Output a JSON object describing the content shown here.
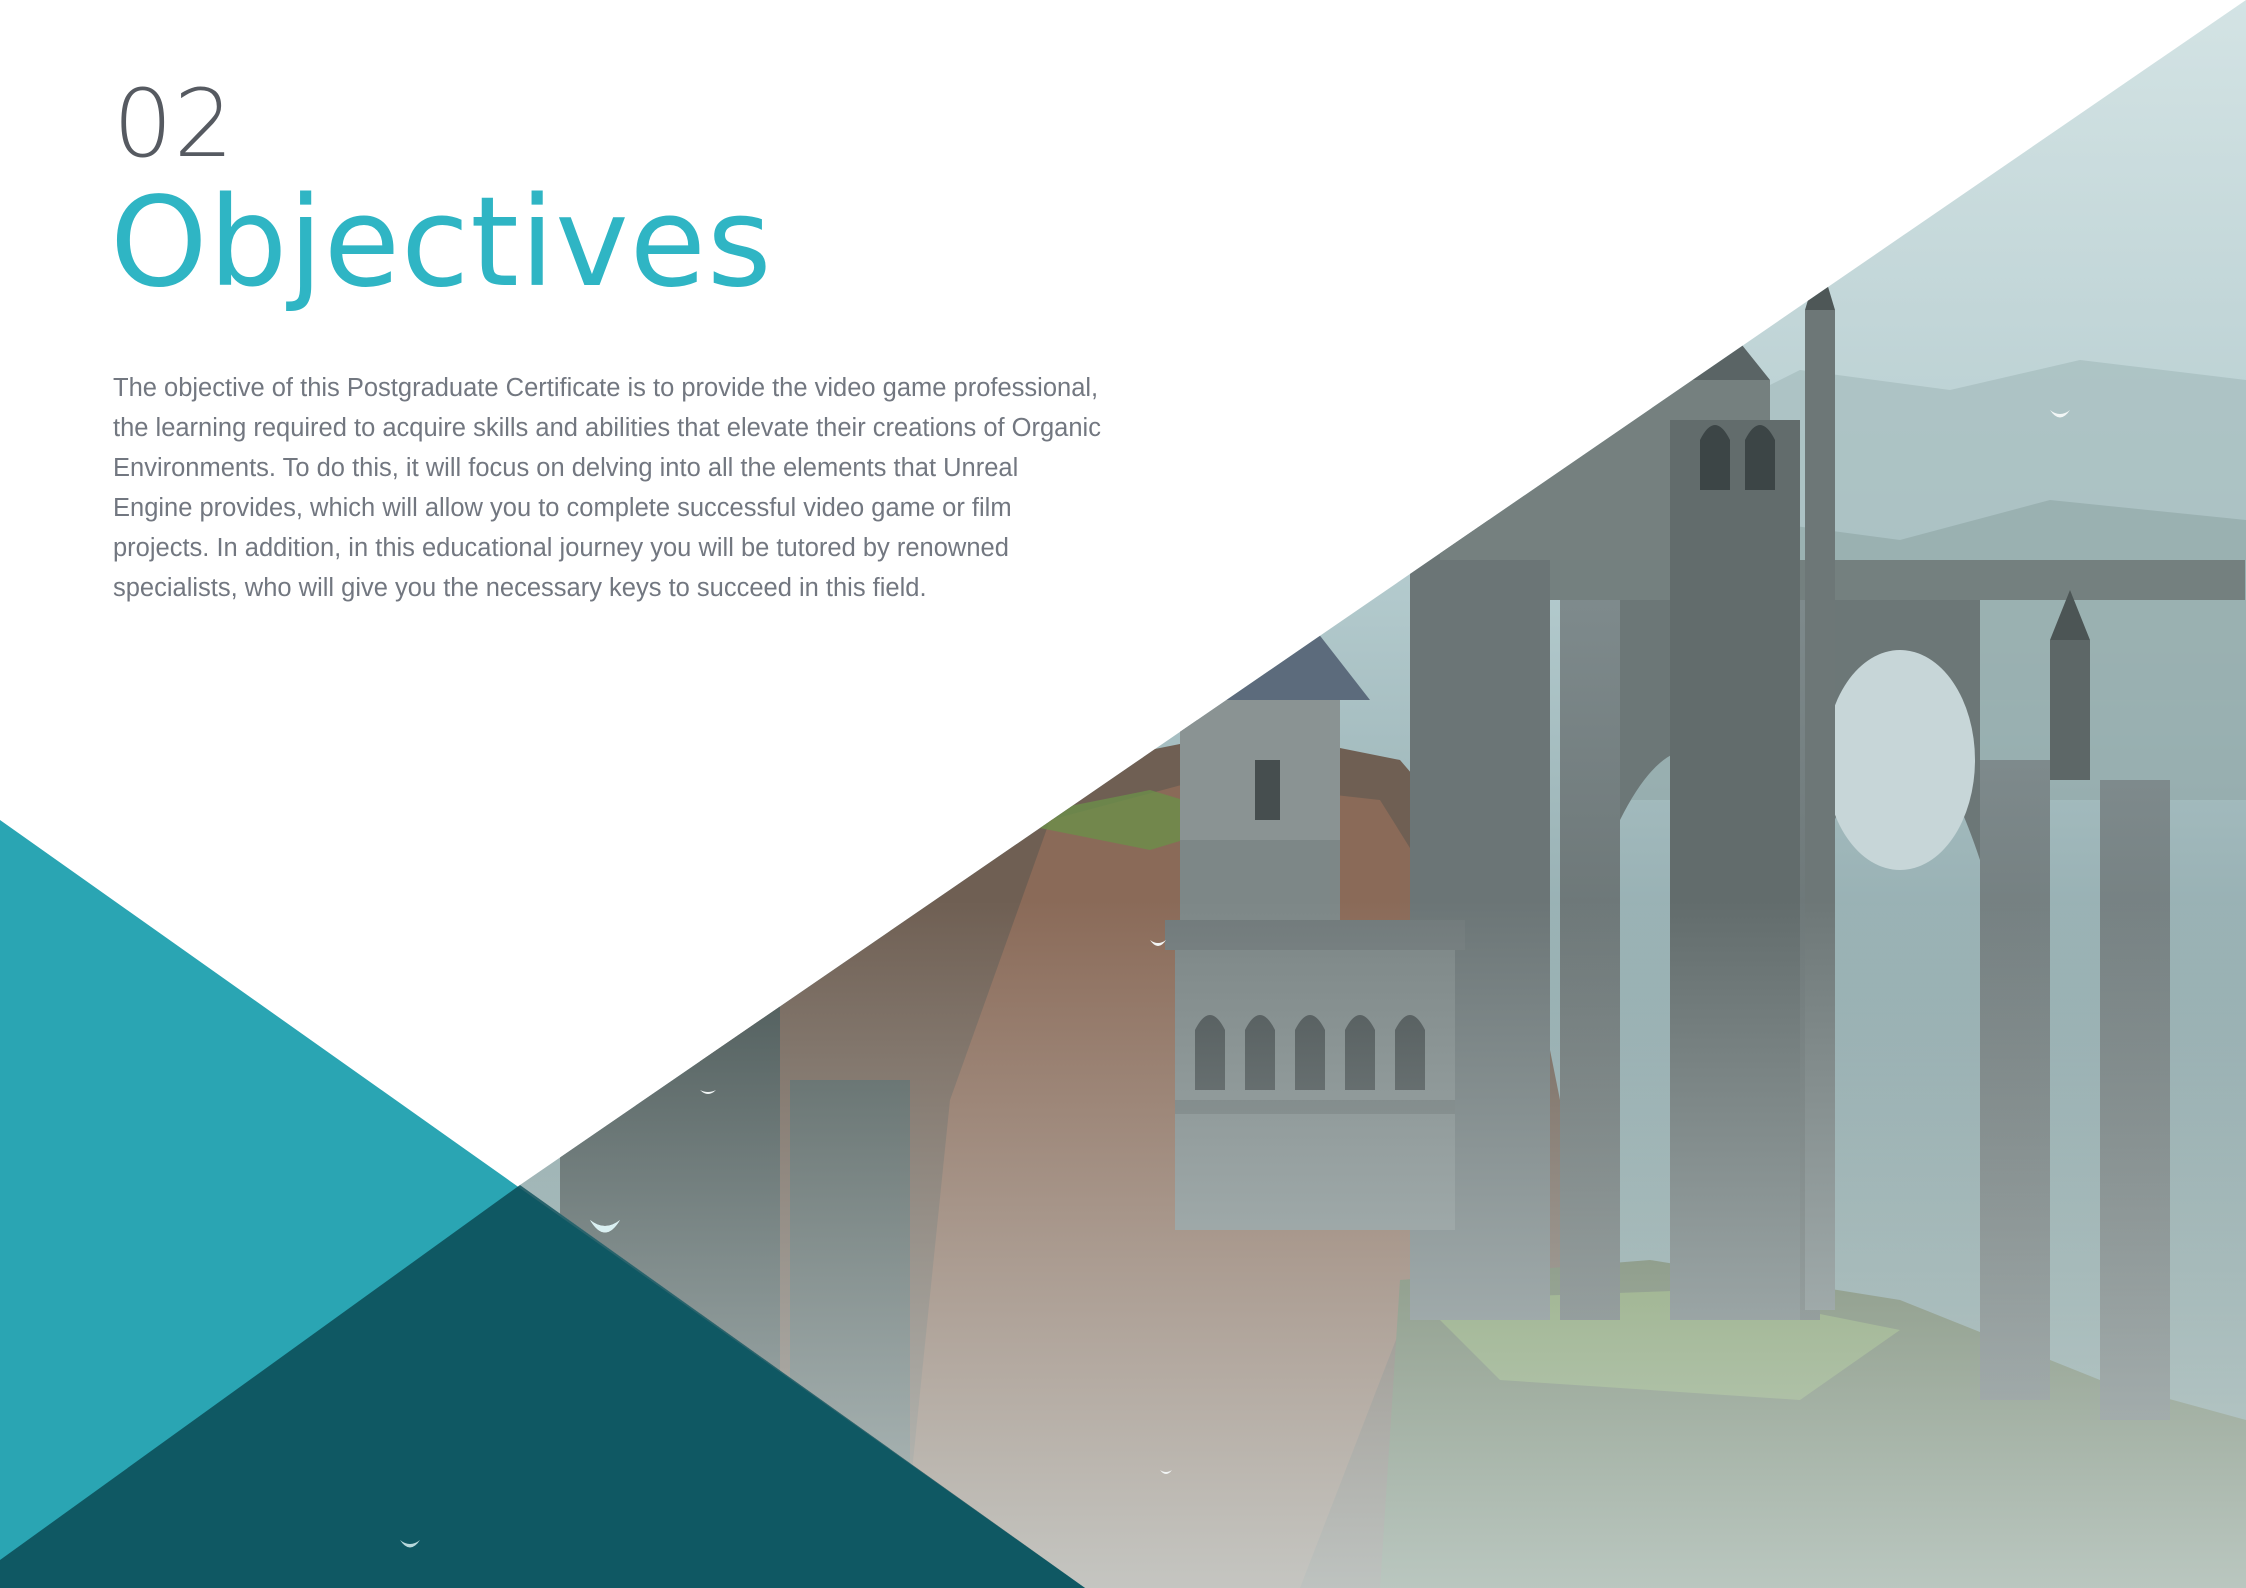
{
  "section": {
    "number": "02",
    "title": "Objectives"
  },
  "body": {
    "paragraph": "The objective of this Postgraduate Certificate is to provide the video game professional, the learning required to acquire skills and abilities that elevate their creations of Organic Environments. To do this, it will focus on delving into all the elements that Unreal Engine provides, which will allow you to complete successful video game or film projects. In addition, in this educational journey you will be tutored by renowned specialists, who will give you the necessary keys to succeed in this field."
  },
  "colors": {
    "accent": "#2fb5c4",
    "teal_panel": "#2aa5b3",
    "number_text": "#565a61",
    "body_text": "#727780"
  },
  "illustration": {
    "subject": "fantasy-castle-ruins-on-cliffs-image"
  }
}
